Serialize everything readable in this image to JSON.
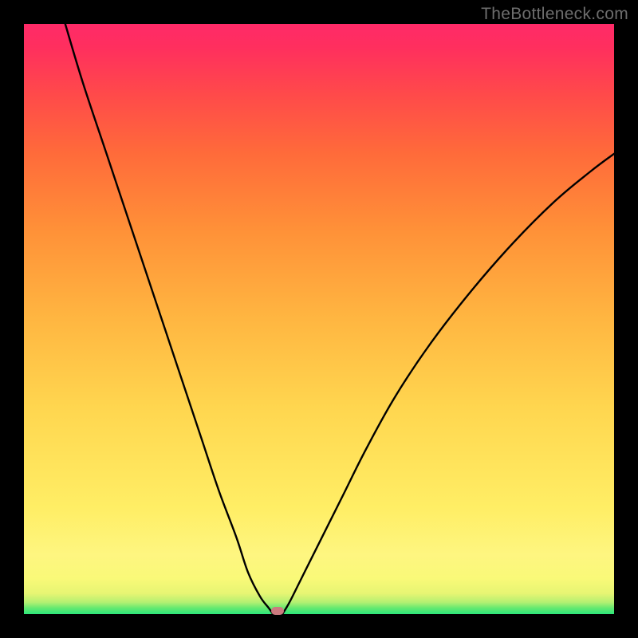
{
  "watermark": "TheBottleneck.com",
  "colors": {
    "frame": "#000000",
    "gradient_stops": [
      {
        "pos": 0.0,
        "hex": "#2ce77a"
      },
      {
        "pos": 0.01,
        "hex": "#63e970"
      },
      {
        "pos": 0.02,
        "hex": "#b4f072"
      },
      {
        "pos": 0.035,
        "hex": "#e7f573"
      },
      {
        "pos": 0.06,
        "hex": "#f9f978"
      },
      {
        "pos": 0.1,
        "hex": "#fef680"
      },
      {
        "pos": 0.18,
        "hex": "#ffee65"
      },
      {
        "pos": 0.35,
        "hex": "#ffd64f"
      },
      {
        "pos": 0.5,
        "hex": "#ffb641"
      },
      {
        "pos": 0.65,
        "hex": "#ff9138"
      },
      {
        "pos": 0.78,
        "hex": "#ff6b3a"
      },
      {
        "pos": 0.88,
        "hex": "#ff4a4a"
      },
      {
        "pos": 0.96,
        "hex": "#ff2f5e"
      },
      {
        "pos": 1.0,
        "hex": "#ff2a68"
      }
    ],
    "curve": "#000000",
    "marker": "#cc7a7f"
  },
  "chart_data": {
    "type": "line",
    "title": "",
    "xlabel": "",
    "ylabel": "",
    "xlim": [
      0,
      100
    ],
    "ylim": [
      0,
      100
    ],
    "grid": false,
    "legend": false,
    "note": "Bottleneck-style V curve; y≈0 at optimum, rises toward 100 away from it. Background hue gradient maps y (green=0 → red=100).",
    "series": [
      {
        "name": "left_branch",
        "x": [
          7,
          10,
          14,
          18,
          22,
          26,
          30,
          33,
          36,
          38,
          40,
          41.5,
          42.2
        ],
        "values": [
          100,
          90,
          78,
          66,
          54,
          42,
          30,
          21,
          13,
          7,
          3,
          1,
          0
        ]
      },
      {
        "name": "right_branch",
        "x": [
          43.8,
          45,
          47,
          50,
          54,
          58,
          63,
          69,
          76,
          83,
          90,
          96,
          100
        ],
        "values": [
          0,
          2,
          6,
          12,
          20,
          28,
          37,
          46,
          55,
          63,
          70,
          75,
          78
        ]
      }
    ],
    "marker": {
      "x": 43,
      "y": 0.5
    }
  }
}
